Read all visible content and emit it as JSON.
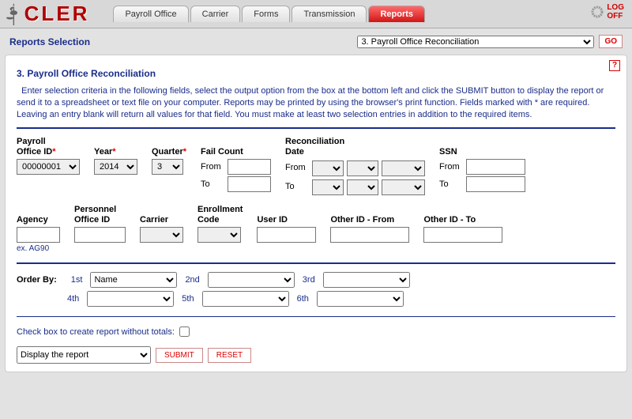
{
  "app": {
    "logo_text": "CLER",
    "logoff1": "LOG",
    "logoff2": "OFF"
  },
  "tabs": [
    "Payroll Office",
    "Carrier",
    "Forms",
    "Transmission",
    "Reports"
  ],
  "active_tab": 4,
  "selection": {
    "title": "Reports Selection",
    "dropdown": "3. Payroll Office Reconciliation",
    "go": "GO"
  },
  "report": {
    "title": "3. Payroll Office Reconciliation",
    "instructions": "Enter selection criteria in the following fields, select the output option from the box at the bottom left and click the SUBMIT button to display the report or send it to a spreadsheet or text file on your computer.  Reports may be printed by using the browser's print function.  Fields marked with * are required.  Leaving an entry blank will return all values for that field.  You must make at least two selection entries in addition to the required items."
  },
  "fields": {
    "payroll_lbl1": "Payroll",
    "payroll_lbl2": "Office ID",
    "payroll_val": "00000001",
    "year_lbl": "Year",
    "year_val": "2014",
    "quarter_lbl": "Quarter",
    "quarter_val": "3",
    "fail_lbl": "Fail Count",
    "from": "From",
    "to": "To",
    "recon_lbl1": "Reconciliation",
    "recon_lbl2": "Date",
    "ssn_lbl": "SSN",
    "agency_lbl": "Agency",
    "agency_hint": "ex. AG90",
    "personnel_lbl1": "Personnel",
    "personnel_lbl2": "Office ID",
    "carrier_lbl": "Carrier",
    "enroll_lbl1": "Enrollment",
    "enroll_lbl2": "Code",
    "userid_lbl": "User ID",
    "oidf_lbl": "Other ID - From",
    "oidt_lbl": "Other ID - To"
  },
  "order": {
    "title": "Order By:",
    "l1": "1st",
    "v1": "Name",
    "l2": "2nd",
    "l3": "3rd",
    "l4": "4th",
    "l5": "5th",
    "l6": "6th"
  },
  "totals": {
    "label": "Check box to create report without totals:"
  },
  "actions": {
    "display": "Display the report",
    "submit": "SUBMIT",
    "reset": "RESET"
  }
}
